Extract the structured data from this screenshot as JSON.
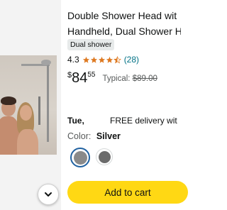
{
  "product": {
    "title_line1": "Double Shower Head wit",
    "title_line2": "Handheld, Dual Shower H",
    "badge": "Dual shower",
    "rating": "4.3",
    "stars_filled": 4.3,
    "reviews": "(28)",
    "price": {
      "currency": "$",
      "dollars": "84",
      "cents": "55",
      "typical_label": "Typical:",
      "typical_value": "$89.00"
    },
    "delivery": {
      "day": "Tue,",
      "text": "FREE delivery wit"
    },
    "color": {
      "label": "Color:",
      "value": "Silver",
      "swatches": [
        {
          "name": "Silver",
          "hex": "#8a8a8a",
          "selected": true
        },
        {
          "name": "Dark",
          "hex": "#6b6b6b",
          "selected": false
        }
      ]
    },
    "add_to_cart": "Add to cart"
  },
  "icons": {
    "expand": "chevron-down-icon",
    "star": "star-icon"
  },
  "colors": {
    "cart_button": "#ffd814",
    "star": "#de7921",
    "link": "#007185",
    "selected_swatch_border": "#2162a1"
  }
}
